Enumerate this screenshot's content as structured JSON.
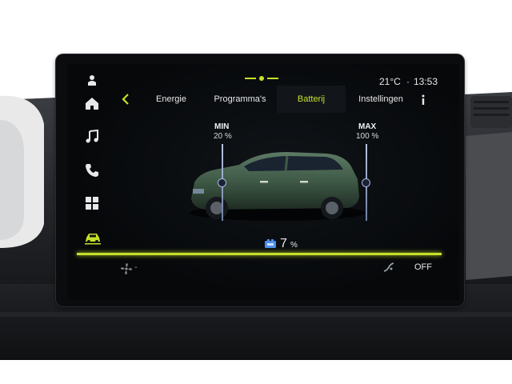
{
  "status_bar": {
    "temperature": "21°C",
    "separator": "·",
    "time": "13:53"
  },
  "tabs": [
    {
      "label": "Energie",
      "active": false
    },
    {
      "label": "Programma's",
      "active": false
    },
    {
      "label": "Batterij",
      "active": true
    },
    {
      "label": "Instellingen",
      "active": false
    }
  ],
  "sidebar": {
    "icons": [
      "person-icon",
      "home-icon",
      "music-icon",
      "phone-icon",
      "apps-icon",
      "car-icon"
    ],
    "active_icon": "car-icon"
  },
  "battery": {
    "min_label": "MIN",
    "min_value": "20 %",
    "max_label": "MAX",
    "max_value": "100 %",
    "charge_percent": 7,
    "charge_value": "7",
    "charge_unit": "%"
  },
  "climate": {
    "fan_level_label": "-",
    "ac_state": "OFF"
  },
  "colors": {
    "accent": "#c6e02a",
    "slider": "#a9b8e8",
    "car_body": "#3f5a47",
    "battery_icon": "#4d8fe8"
  }
}
